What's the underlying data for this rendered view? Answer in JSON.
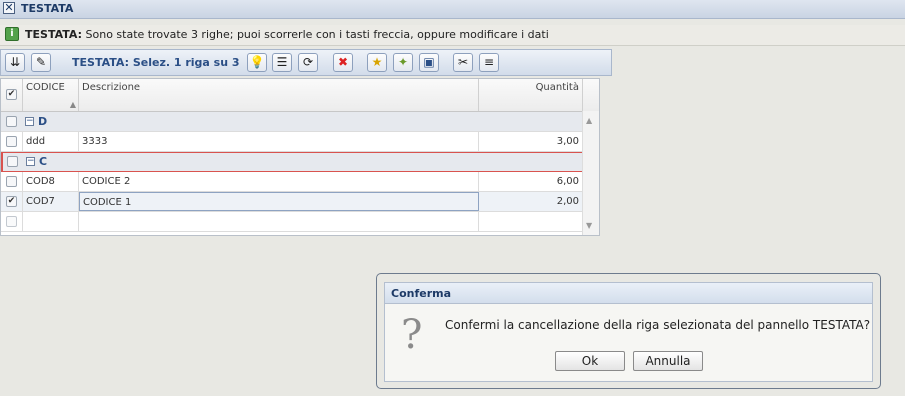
{
  "window": {
    "title": "TESTATA",
    "close_glyph": "✕"
  },
  "status": {
    "panel": "TESTATA:",
    "message": "Sono state trovate 3 righe; puoi scorrerle con i tasti freccia, oppure modificare i dati"
  },
  "toolbar": {
    "title": "TESTATA: Selez. 1 riga su 3",
    "icons": [
      "collapse-icon",
      "edit-icon",
      "lightbulb-icon",
      "list-icon",
      "refresh-icon",
      "delete-icon",
      "star-icon",
      "star-add-icon",
      "save-icon",
      "export-icon",
      "layout-icon"
    ]
  },
  "grid": {
    "columns": {
      "code": "CODICE",
      "desc": "Descrizione",
      "qty": "Quantità"
    },
    "groups": [
      {
        "label": "D",
        "rows": [
          {
            "code": "ddd",
            "desc": "3333",
            "qty": "3,00"
          }
        ]
      },
      {
        "label": "C",
        "rows": [
          {
            "code": "COD8",
            "desc": "CODICE 2",
            "qty": "6,00"
          },
          {
            "code": "COD7",
            "desc": "CODICE 1",
            "qty": "2,00",
            "checked": true
          }
        ]
      }
    ]
  },
  "dialog": {
    "title": "Conferma",
    "message": "Confermi la cancellazione della riga selezionata del pannello TESTATA?",
    "ok": "Ok",
    "cancel": "Annulla"
  },
  "colors": {
    "accent": "#1d3a66",
    "selection": "#d9534f"
  }
}
